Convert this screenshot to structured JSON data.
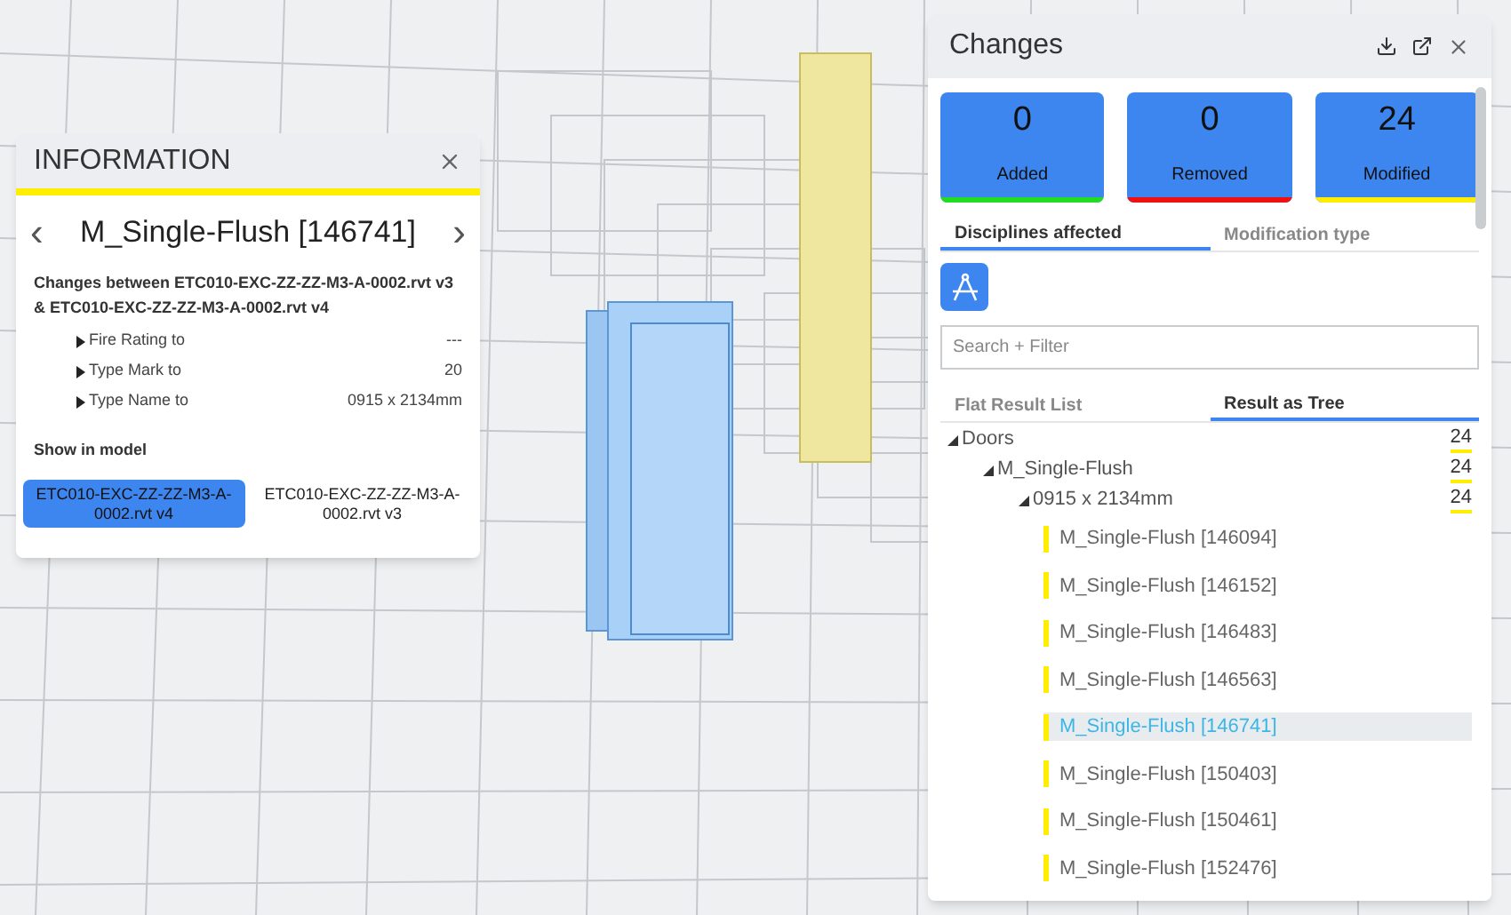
{
  "information": {
    "title": "INFORMATION",
    "heading": "M_Single-Flush [146741]",
    "prev": "‹",
    "next": "›",
    "summary": "Changes between ETC010-EXC-ZZ-ZZ-M3-A-0002.rvt v3 & ETC010-EXC-ZZ-ZZ-M3-A-0002.rvt v4",
    "properties": [
      {
        "label": "Fire Rating to",
        "value": "---",
        "expanded": false
      },
      {
        "label": "Type Mark to",
        "value": "20",
        "expanded": false
      },
      {
        "label": "Type Name to",
        "value": "0915 x 2134mm",
        "expanded": false
      }
    ],
    "show_label": "Show in model",
    "versions": [
      {
        "label": "ETC010-EXC-ZZ-ZZ-M3-A-0002.rvt v4",
        "selected": true
      },
      {
        "label": "ETC010-EXC-ZZ-ZZ-M3-A-0002.rvt v3",
        "selected": false
      }
    ]
  },
  "changes": {
    "title": "Changes",
    "stats": [
      {
        "count": "0",
        "label": "Added",
        "color": "#22dd22"
      },
      {
        "count": "0",
        "label": "Removed",
        "color": "#ee1111"
      },
      {
        "count": "24",
        "label": "Modified",
        "color": "#ffee00"
      }
    ],
    "tabs": [
      {
        "label": "Disciplines affected",
        "selected": true
      },
      {
        "label": "Modification type",
        "selected": false
      }
    ],
    "search": {
      "placeholder": "Search + Filter"
    },
    "view_tabs": [
      {
        "label": "Flat Result List",
        "selected": false
      },
      {
        "label": "Result as Tree",
        "selected": true
      }
    ],
    "tree": [
      {
        "label": "Doors",
        "count": "24",
        "expanded": true,
        "children": [
          {
            "label": "M_Single-Flush",
            "count": "24",
            "expanded": true,
            "children": [
              {
                "label": "0915 x 2134mm",
                "count": "24",
                "expanded": true,
                "children": [
                  {
                    "label": "M_Single-Flush [146094]",
                    "selected": false
                  },
                  {
                    "label": "M_Single-Flush [146152]",
                    "selected": false
                  },
                  {
                    "label": "M_Single-Flush [146483]",
                    "selected": false
                  },
                  {
                    "label": "M_Single-Flush [146563]",
                    "selected": false
                  },
                  {
                    "label": "M_Single-Flush [146741]",
                    "selected": true
                  },
                  {
                    "label": "M_Single-Flush [150403]",
                    "selected": false
                  },
                  {
                    "label": "M_Single-Flush [150461]",
                    "selected": false
                  },
                  {
                    "label": "M_Single-Flush [152476]",
                    "selected": false
                  }
                ]
              }
            ]
          }
        ]
      }
    ]
  }
}
